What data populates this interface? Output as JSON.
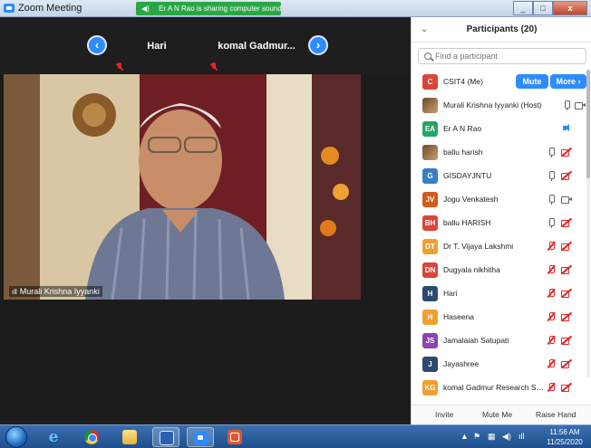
{
  "window": {
    "title": "Zoom Meeting",
    "sharing_banner": "Er A N Rao is sharing computer sound",
    "minimize": "_",
    "maximize": "□",
    "close": "x"
  },
  "thumbnails": [
    {
      "name": "Hari"
    },
    {
      "name": "komal Gadmur..."
    }
  ],
  "nav": {
    "prev": "‹",
    "next": "›"
  },
  "main_video": {
    "speaker_label": "Murali Krishna Iyyanki",
    "signal_bars": "ıll"
  },
  "panel": {
    "title": "Participants (20)",
    "collapse": "⌄",
    "search_placeholder": "Find a participant",
    "me_mute_button": "Mute",
    "me_more_button": "More ›",
    "participants": [
      {
        "initials": "C",
        "name": "CSIT4 (Me)",
        "color": "#d9453a"
      },
      {
        "initials": "",
        "name": "Murali Krishna Iyyanki (Host)",
        "color": "#8a6a4a"
      },
      {
        "initials": "EA",
        "name": "Er A N Rao",
        "color": "#27a567"
      },
      {
        "initials": "",
        "name": "ballu harish",
        "color": "#8a6a4a"
      },
      {
        "initials": "G",
        "name": "GISDAYJNTU",
        "color": "#3a7fc4"
      },
      {
        "initials": "JV",
        "name": "Jogu Venkatesh",
        "color": "#d35a1a"
      },
      {
        "initials": "BH",
        "name": "ballu HARISH",
        "color": "#d9453a"
      },
      {
        "initials": "DT",
        "name": "Dr T. Vijaya Lakshmi",
        "color": "#f0a030"
      },
      {
        "initials": "DN",
        "name": "Dugyala nikhitha",
        "color": "#d9453a"
      },
      {
        "initials": "H",
        "name": "Hari",
        "color": "#2c4a6e"
      },
      {
        "initials": "H",
        "name": "Haseena",
        "color": "#f0a030"
      },
      {
        "initials": "JS",
        "name": "Jamalaiah Satupati",
        "color": "#8e44ad"
      },
      {
        "initials": "J",
        "name": "Jayashree",
        "color": "#2c4a6e"
      },
      {
        "initials": "KG",
        "name": "komal Gadmur Research Schola...",
        "color": "#f0a030"
      }
    ],
    "footer": {
      "invite": "Invite",
      "mute_me": "Mute Me",
      "raise_hand": "Raise Hand"
    }
  },
  "taskbar": {
    "ie_glyph": "e",
    "clock_time": "11:56 AM",
    "clock_date": "11/25/2020",
    "tray_arrow": "▲"
  }
}
